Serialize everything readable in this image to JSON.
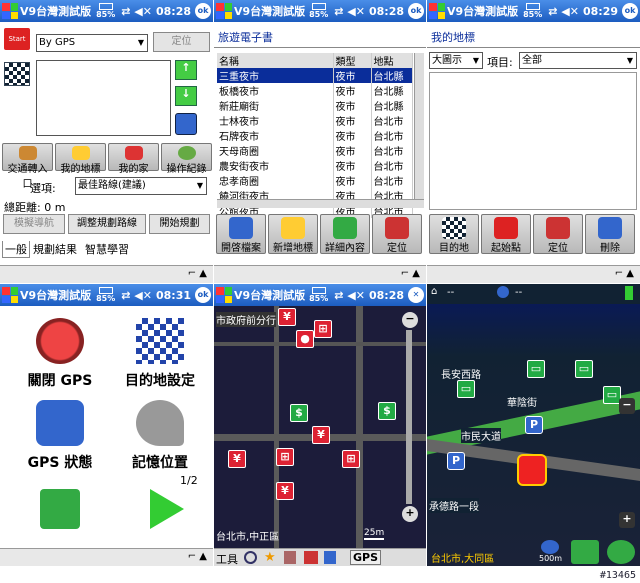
{
  "status": {
    "title": "V9台灣測試版",
    "battery": "85%",
    "times": [
      "08:28",
      "08:28",
      "08:29",
      "08:31",
      "08:28"
    ],
    "ok": "ok",
    "sig": "⇄ ◀✕"
  },
  "p1": {
    "gps_select": "By GPS",
    "locate": "定位",
    "start": "Start",
    "btn_icons": [
      "交通轉入口",
      "我的地標",
      "我的家",
      "操作紀錄"
    ],
    "opt_label": "選項:",
    "opt_value": "最佳路線(建議)",
    "total": "總距離: 0 m",
    "actions": [
      "模擬導航",
      "調整規劃路線",
      "開始規劃"
    ],
    "tabs": [
      "一般",
      "規劃結果",
      "智慧學習"
    ]
  },
  "p2": {
    "heading": "旅遊電子書",
    "cols": [
      "名稱",
      "類型",
      "地點"
    ],
    "rows": [
      [
        "三重夜市",
        "夜市",
        "台北縣"
      ],
      [
        "板橋夜市",
        "夜市",
        "台北縣"
      ],
      [
        "新莊廟街",
        "夜市",
        "台北縣"
      ],
      [
        "士林夜市",
        "夜市",
        "台北市"
      ],
      [
        "石牌夜市",
        "夜市",
        "台北市"
      ],
      [
        "天母商圈",
        "夜市",
        "台北市"
      ],
      [
        "農安街夜市",
        "夜市",
        "台北市"
      ],
      [
        "忠孝商圈",
        "夜市",
        "台北市"
      ],
      [
        "饒河街夜市",
        "夜市",
        "台北市"
      ],
      [
        "公館夜市",
        "夜市",
        "台北市"
      ]
    ],
    "buttons": [
      "開啓檔案",
      "新增地標",
      "詳細內容",
      "定位"
    ]
  },
  "p3": {
    "heading": "我的地標",
    "view": "大圖示",
    "item_label": "項目:",
    "item_value": "全部",
    "buttons": [
      "目的地",
      "起始點",
      "定位",
      "刪除"
    ]
  },
  "p4": {
    "tiles": [
      "關閉 GPS",
      "目的地設定",
      "GPS 狀態",
      "記憶位置"
    ],
    "page": "1/2"
  },
  "p5": {
    "top_label": "市政府前分行",
    "location": "台北市,中正區",
    "scale": "25m",
    "toolbar": "工具",
    "gps": "GPS"
  },
  "p6": {
    "gps_text": "--",
    "clock_text": "--",
    "roads": [
      "長安西路",
      "華陰街",
      "市民大道",
      "承德路一段"
    ],
    "location": "台北市,大同區",
    "scale": "500m"
  },
  "watermark": "#13465",
  "colors": {
    "titlebar": "#1c5cc0",
    "selected": "#0a2d9a",
    "map_bg": "#1c1c3a"
  }
}
